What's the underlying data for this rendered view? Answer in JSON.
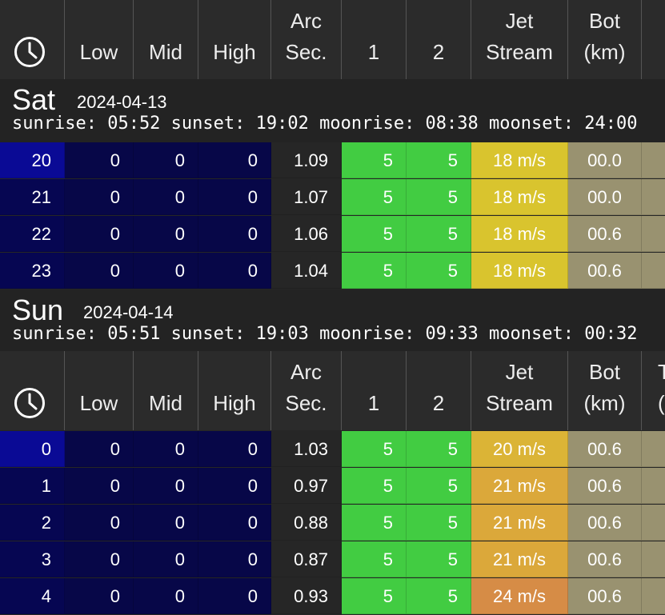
{
  "headers": {
    "time_icon": "clock-icon",
    "low": "Low",
    "mid": "Mid",
    "high": "High",
    "arc_line1": "Arc",
    "arc_line2": "Sec.",
    "see1": "1",
    "see2": "2",
    "jet_line1": "Jet",
    "jet_line2": "Stream",
    "bot_line1": "Bot",
    "bot_line2": "(km)",
    "extra_partial": "T"
  },
  "days": [
    {
      "name": "Sat",
      "date": "2024-04-13",
      "astro": "sunrise: 05:52 sunset: 19:02 moonrise: 08:38 moonset: 24:00",
      "rows": [
        {
          "hour": "20",
          "low": "0",
          "mid": "0",
          "high": "0",
          "arc": "1.09",
          "s1": "5",
          "s2": "5",
          "jet": "18 m/s",
          "bot": "00.0"
        },
        {
          "hour": "21",
          "low": "0",
          "mid": "0",
          "high": "0",
          "arc": "1.07",
          "s1": "5",
          "s2": "5",
          "jet": "18 m/s",
          "bot": "00.0"
        },
        {
          "hour": "22",
          "low": "0",
          "mid": "0",
          "high": "0",
          "arc": "1.06",
          "s1": "5",
          "s2": "5",
          "jet": "18 m/s",
          "bot": "00.6"
        },
        {
          "hour": "23",
          "low": "0",
          "mid": "0",
          "high": "0",
          "arc": "1.04",
          "s1": "5",
          "s2": "5",
          "jet": "18 m/s",
          "bot": "00.6"
        }
      ]
    },
    {
      "name": "Sun",
      "date": "2024-04-14",
      "astro": "sunrise: 05:51 sunset: 19:03 moonrise: 09:33 moonset: 00:32",
      "rows": [
        {
          "hour": "0",
          "low": "0",
          "mid": "0",
          "high": "0",
          "arc": "1.03",
          "s1": "5",
          "s2": "5",
          "jet": "20 m/s",
          "bot": "00.6"
        },
        {
          "hour": "1",
          "low": "0",
          "mid": "0",
          "high": "0",
          "arc": "0.97",
          "s1": "5",
          "s2": "5",
          "jet": "21 m/s",
          "bot": "00.6"
        },
        {
          "hour": "2",
          "low": "0",
          "mid": "0",
          "high": "0",
          "arc": "0.88",
          "s1": "5",
          "s2": "5",
          "jet": "21 m/s",
          "bot": "00.6"
        },
        {
          "hour": "3",
          "low": "0",
          "mid": "0",
          "high": "0",
          "arc": "0.87",
          "s1": "5",
          "s2": "5",
          "jet": "21 m/s",
          "bot": "00.6"
        },
        {
          "hour": "4",
          "low": "0",
          "mid": "0",
          "high": "0",
          "arc": "0.93",
          "s1": "5",
          "s2": "5",
          "jet": "24 m/s",
          "bot": "00.6"
        }
      ]
    }
  ],
  "colors": {
    "background": "#262626",
    "header_bg": "#2b2b2b",
    "hour_night": "#060652",
    "hour_dusk": "#0a0a95",
    "cloud_clear": "#070748",
    "seeing_good": "#42cc42",
    "jet_18": "#d9c42e",
    "jet_20": "#dbb436",
    "jet_21": "#dba83a",
    "jet_24": "#d68c46",
    "bot": "#999270"
  }
}
